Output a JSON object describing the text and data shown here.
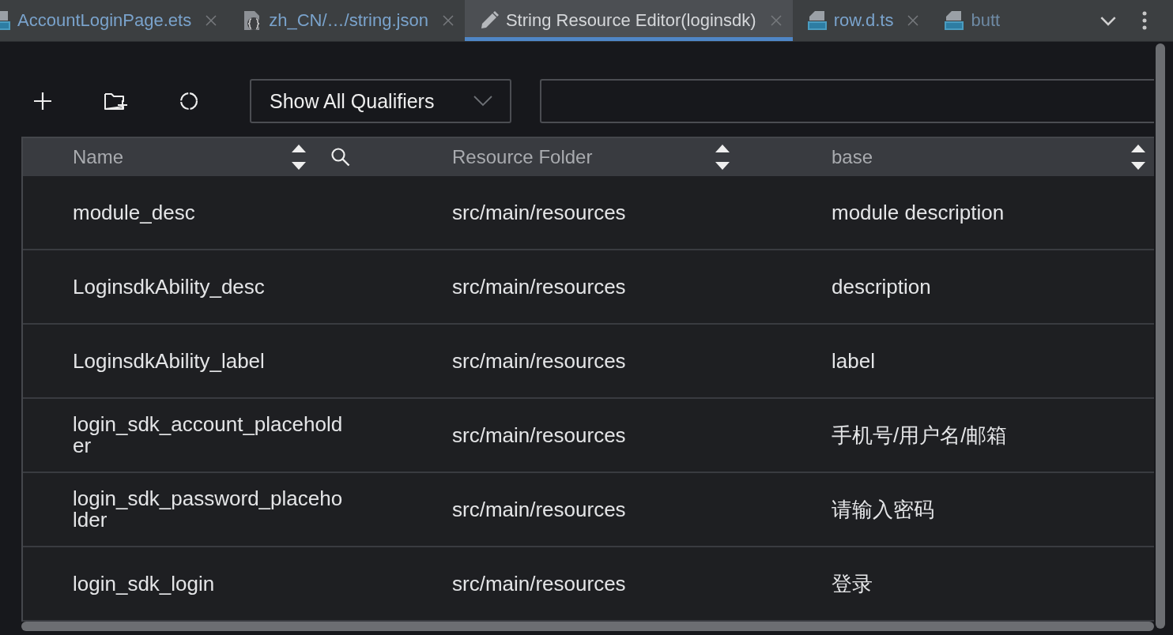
{
  "tabs": [
    {
      "label": "AccountLoginPage.ets",
      "kind": "code",
      "selected": false,
      "closable": true
    },
    {
      "label": "zh_CN/…/string.json",
      "kind": "json",
      "selected": false,
      "closable": true
    },
    {
      "label": "String Resource Editor(loginsdk)",
      "kind": "editor",
      "selected": true,
      "closable": true
    },
    {
      "label": "row.d.ts",
      "kind": "code",
      "selected": false,
      "closable": true
    },
    {
      "label": "butt",
      "kind": "code",
      "selected": false,
      "closable": false
    }
  ],
  "toolbar": {
    "qualifier_dropdown": "Show All Qualifiers"
  },
  "table": {
    "columns": [
      {
        "label": "Name"
      },
      {
        "label": "Resource Folder"
      },
      {
        "label": "base"
      }
    ],
    "rows": [
      [
        "module_desc",
        "src/main/resources",
        "module description"
      ],
      [
        "LoginsdkAbility_desc",
        "src/main/resources",
        "description"
      ],
      [
        "LoginsdkAbility_label",
        "src/main/resources",
        "label"
      ],
      [
        "login_sdk_account_placeholder",
        "src/main/resources",
        "手机号/用户名/邮箱"
      ],
      [
        "login_sdk_password_placeholder",
        "src/main/resources",
        "请输入密码"
      ],
      [
        "login_sdk_login",
        "src/main/resources",
        "登录"
      ]
    ]
  }
}
